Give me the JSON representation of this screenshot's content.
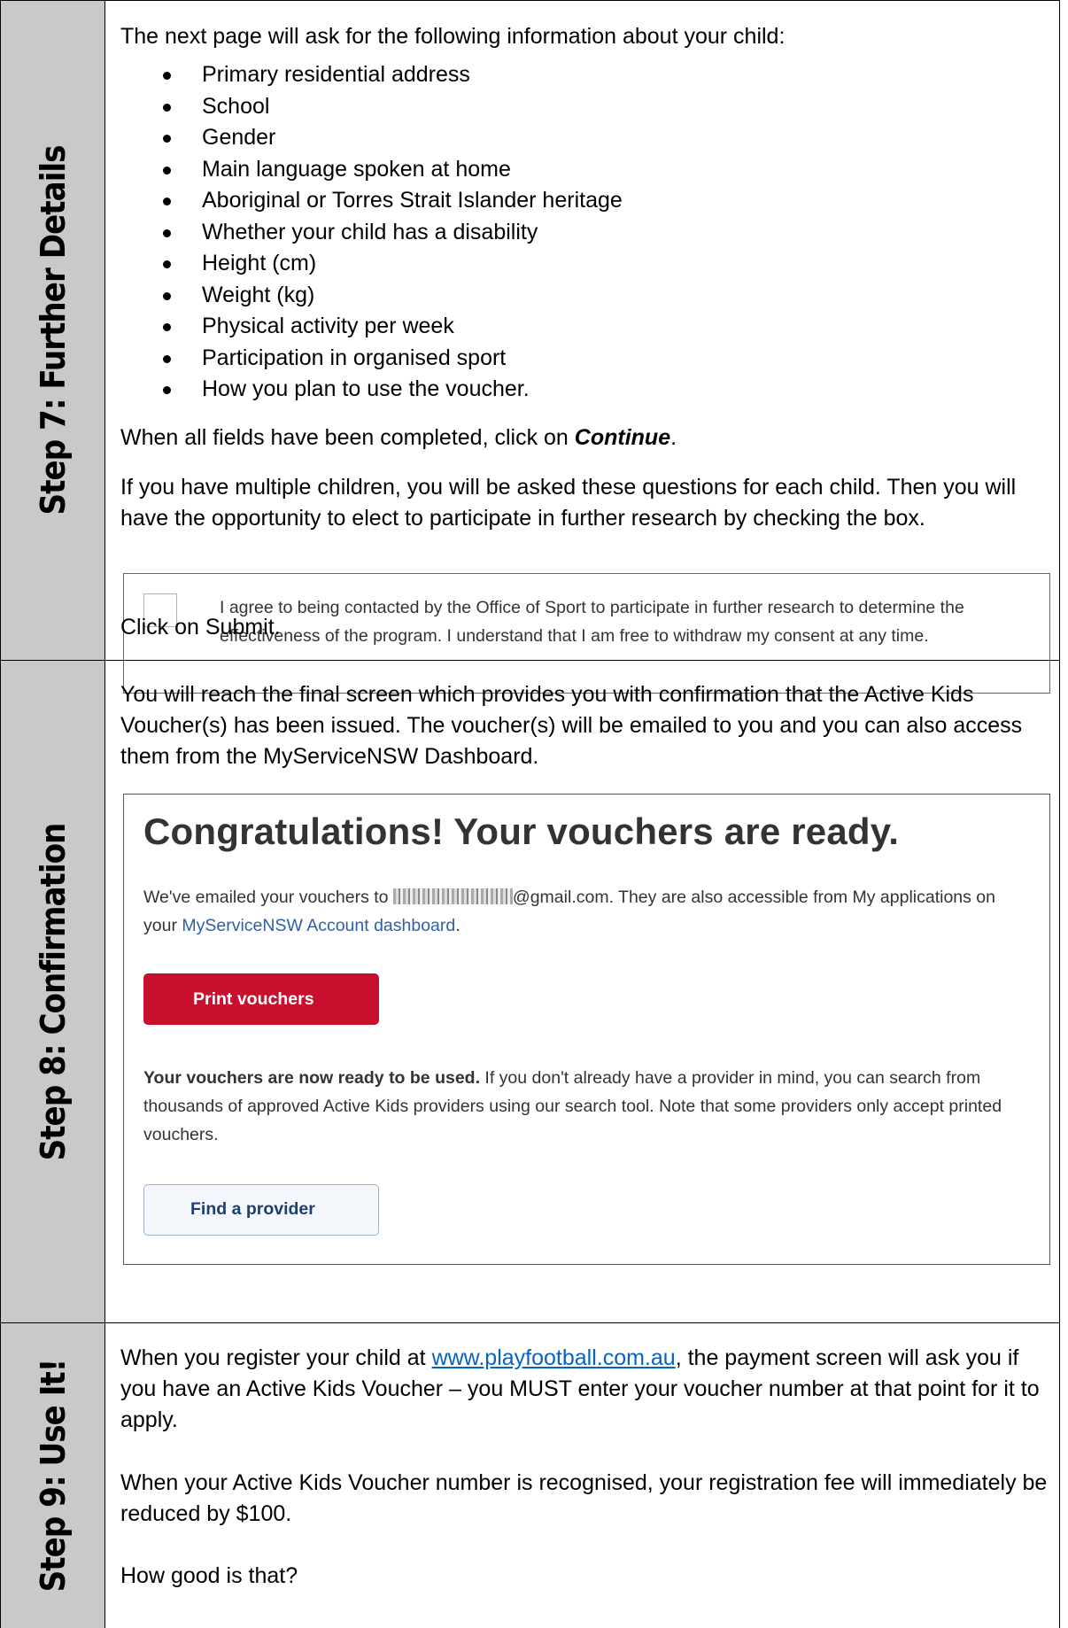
{
  "step7": {
    "label": "Step 7: Further Details",
    "intro": "The next page will ask for the following information about your child:",
    "items": [
      "Primary residential address",
      "School",
      "Gender",
      "Main language spoken at home",
      "Aboriginal or Torres Strait Islander heritage",
      "Whether your child has a disability",
      "Height (cm)",
      "Weight (kg)",
      "Physical activity per week",
      "Participation in organised sport",
      "How you plan to use the voucher."
    ],
    "continue_pre": "When all fields have been completed, click on ",
    "continue_word": "Continue",
    "continue_post": ".",
    "multiple_children": "If you have multiple children, you will be asked these questions for each child. Then you will have the opportunity to elect to participate in further research by checking the box.",
    "consent_text": "I agree to being contacted by the Office of Sport to participate in further research to determine the effectiveness of the program. I understand that I am free to withdraw my consent at any time.",
    "submit_text": "Click on Submit."
  },
  "step8": {
    "label": "Step 8: Confirmation",
    "intro": "You will reach the final screen which provides you with confirmation that the Active Kids Voucher(s) has been issued.  The voucher(s) will be emailed to you and you can also access them from the MyServiceNSW Dashboard.",
    "screenshot": {
      "title": "Congratulations! Your vouchers are ready.",
      "email_pre": "We've emailed your vouchers to ",
      "email_domain": "@gmail.com. They are also accessible from My applications on your ",
      "dashboard_link": "MyServiceNSW Account dashboard",
      "email_post": ".",
      "print_button": "Print vouchers",
      "ready_bold": "Your vouchers are now ready to be used.",
      "ready_rest": " If you don't already have a provider in mind, you can search from thousands of approved Active Kids providers using our search tool. Note that some providers only accept printed vouchers.",
      "find_button": "Find a provider"
    }
  },
  "step9": {
    "label": "Step 9: Use It!",
    "p1_pre": "When you register your child at ",
    "p1_link": "www.playfootball.com.au",
    "p1_post": ", the payment screen will ask you if you have an Active Kids Voucher – you MUST enter your voucher number at that point for it to apply.",
    "p2": "When your Active Kids Voucher number is recognised, your registration fee will immediately be reduced by $100.",
    "p3": "How good is that?"
  },
  "colors": {
    "sidebar": "#c9c9c9",
    "print_button": "#c8102e",
    "link": "#0563c1",
    "dashboard_link": "#2e5fa8"
  }
}
